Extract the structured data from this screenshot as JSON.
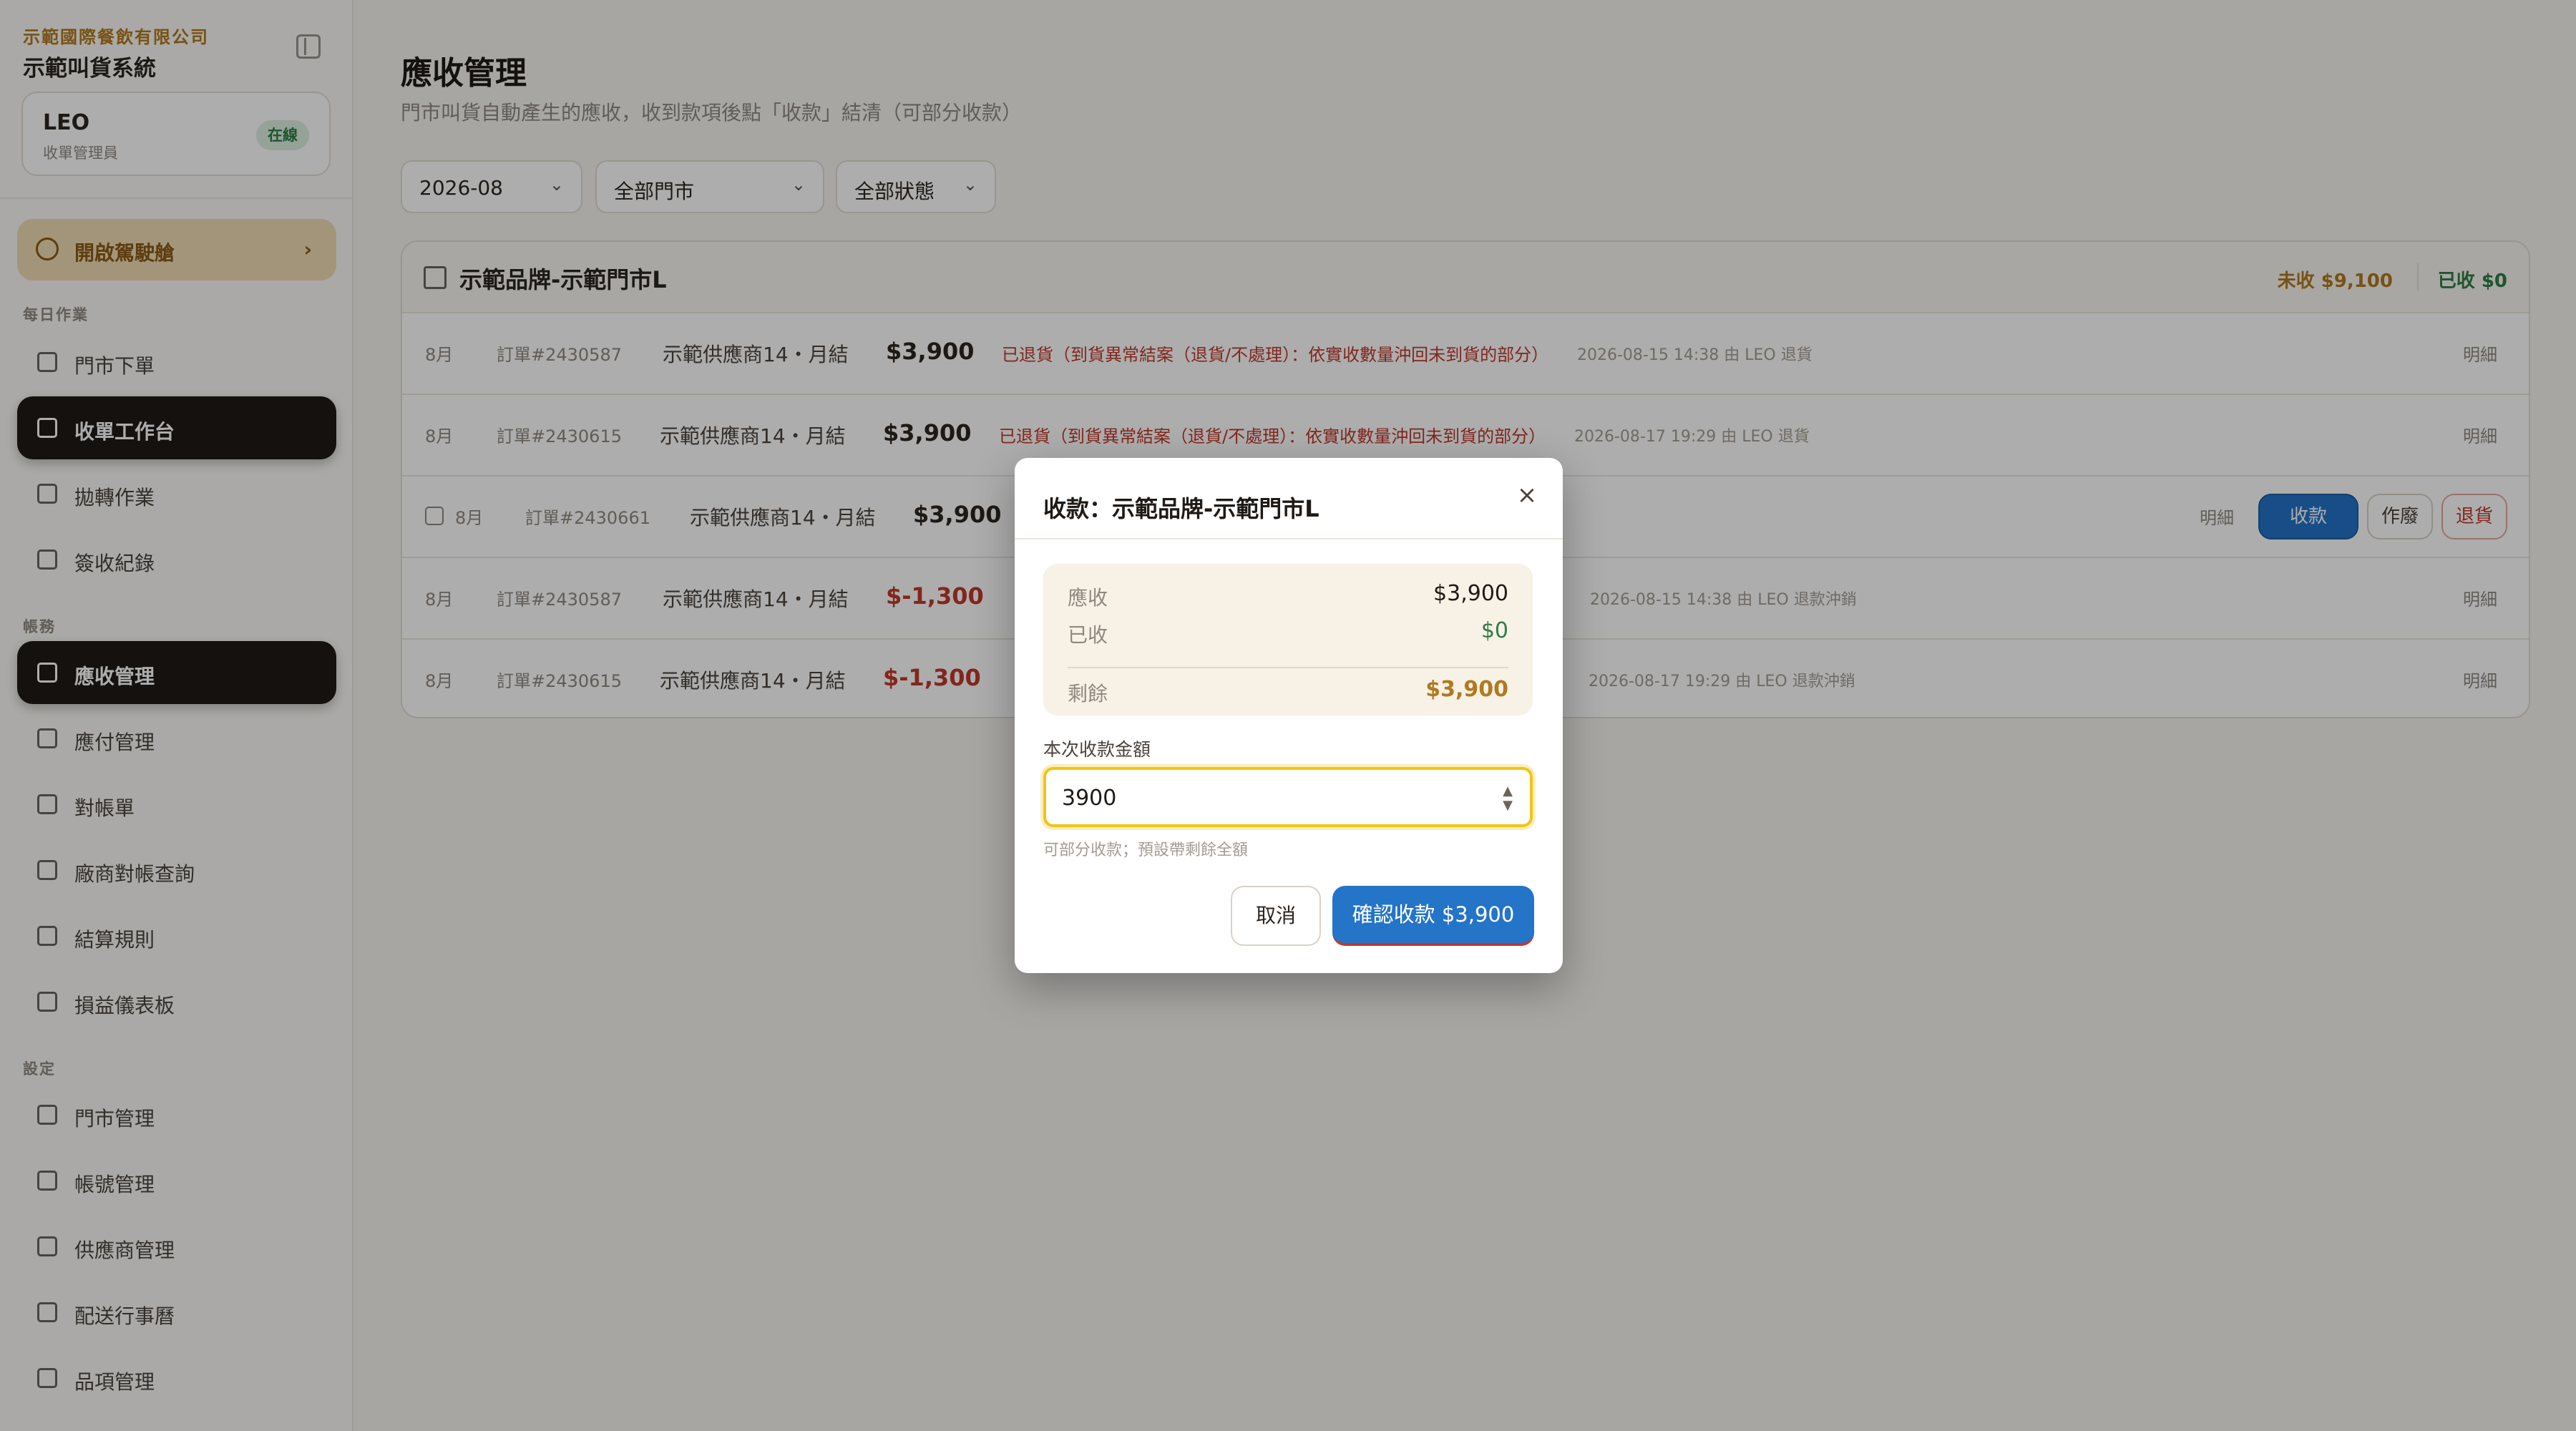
{
  "sidebar": {
    "company": "示範國際餐飲有限公司",
    "system_name": "示範叫貨系統",
    "user": {
      "name": "LEO",
      "role": "收單管理員",
      "status": "在線"
    },
    "cockpit": "開啟駕駛艙",
    "sections": {
      "daily": "每日作業",
      "accounts": "帳務",
      "settings": "設定"
    },
    "items": [
      {
        "label": "門市下單",
        "icon": "cart-icon"
      },
      {
        "label": "收單工作台",
        "icon": "grid-icon"
      },
      {
        "label": "拋轉作業",
        "icon": "send-icon"
      },
      {
        "label": "簽收紀錄",
        "icon": "edit-icon"
      },
      {
        "label": "應收管理",
        "icon": "card-icon"
      },
      {
        "label": "應付管理",
        "icon": "wallet-icon"
      },
      {
        "label": "對帳單",
        "icon": "chart-icon"
      },
      {
        "label": "廠商對帳查詢",
        "icon": "file-icon"
      },
      {
        "label": "結算規則",
        "icon": "receipt-icon"
      },
      {
        "label": "損益儀表板",
        "icon": "bar-chart-icon"
      },
      {
        "label": "門市管理",
        "icon": "store-icon"
      },
      {
        "label": "帳號管理",
        "icon": "users-icon"
      },
      {
        "label": "供應商管理",
        "icon": "truck-icon"
      },
      {
        "label": "配送行事曆",
        "icon": "calendar-icon"
      },
      {
        "label": "品項管理",
        "icon": "box-icon"
      }
    ]
  },
  "page": {
    "title": "應收管理",
    "subtitle": "門市叫貨自動產生的應收，收到款項後點「收款」結清（可部分收款）",
    "filters": {
      "month": "2026-08",
      "store": "全部門市",
      "status": "全部狀態"
    }
  },
  "store_card": {
    "name": "示範品牌-示範門市L",
    "unpaid": "未收 $9,100",
    "paid": "已收 $0",
    "rows": [
      {
        "month": "8月",
        "order": "訂單#2430587",
        "supplier": "示範供應商14・月結",
        "amount": "$3,900",
        "status": "已退貨（到貨異常結案（退貨/不處理）：依實收數量沖回未到貨的部分）",
        "meta": "2026-08-15 14:38 由 LEO 退貨",
        "details": "明細"
      },
      {
        "month": "8月",
        "order": "訂單#2430615",
        "supplier": "示範供應商14・月結",
        "amount": "$3,900",
        "status": "已退貨（到貨異常結案（退貨/不處理）：依實收數量沖回未到貨的部分）",
        "meta": "2026-08-17 19:29 由 LEO 退貨",
        "details": "明細"
      },
      {
        "month": "8月",
        "order": "訂單#2430661",
        "supplier": "示範供應商14・月結",
        "amount": "$3,900",
        "details": "明細",
        "collect": "收款",
        "void": "作廢",
        "refund": "退貨"
      },
      {
        "month": "8月",
        "order": "訂單#2430587",
        "supplier": "示範供應商14・月結",
        "amount": "$-1,300",
        "meta": "2026-08-15 14:38 由 LEO 退款沖銷",
        "details": "明細"
      },
      {
        "month": "8月",
        "order": "訂單#2430615",
        "supplier": "示範供應商14・月結",
        "amount": "$-1,300",
        "meta": "2026-08-17 19:29 由 LEO 退款沖銷",
        "details": "明細"
      }
    ]
  },
  "modal": {
    "title": "收款：示範品牌-示範門市L",
    "receivable_label": "應收",
    "receivable": "$3,900",
    "received_label": "已收",
    "received": "$0",
    "remaining_label": "剩餘",
    "remaining": "$3,900",
    "field_label": "本次收款金額",
    "field_value": "3900",
    "hint": "可部分收款；預設帶剩餘全額",
    "cancel": "取消",
    "confirm": "確認收款 $3,900"
  },
  "colors": {
    "accent": "#2474c7",
    "gold": "#b07a1e",
    "green": "#2f7d45",
    "red": "#c0392b",
    "dark": "#1f1a16"
  }
}
